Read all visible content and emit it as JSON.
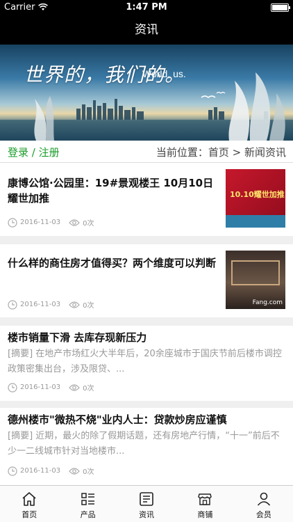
{
  "status_bar": {
    "carrier": "Carrier",
    "time": "1:47 PM"
  },
  "nav": {
    "title": "资讯"
  },
  "banner": {
    "slogan_cn": "世界的，我们的。",
    "slogan_en": "World, us."
  },
  "subheader": {
    "login": "登录 / 注册",
    "breadcrumb": "当前位置：首页 > 新闻资讯"
  },
  "articles": [
    {
      "title": "康博公馆·公园里：19#景观楼王 10月10日耀世加推",
      "summary": "",
      "date": "2016-11-03",
      "views": "0次",
      "thumb_text": "10.10耀世加推"
    },
    {
      "title": "什么样的商住房才值得买？两个维度可以判断",
      "summary": "",
      "date": "2016-11-03",
      "views": "0次",
      "thumb_text": "Fang.com"
    },
    {
      "title": "楼市销量下滑 去库存现新压力",
      "summary": "[摘要] 在地产市场红火大半年后，20余座城市于国庆节前后楼市调控政策密集出台，涉及限贷、...",
      "date": "2016-11-03",
      "views": "0次"
    },
    {
      "title": "德州楼市\"微热不烧\"业内人士：贷款炒房应谨慎",
      "summary": "[摘要] 近期，最火的除了假期话题，还有房地产行情，“十一”前后不少一二线城市针对当地楼市...",
      "date": "2016-11-03",
      "views": "0次"
    }
  ],
  "tabs": [
    {
      "label": "首页",
      "icon": "home-icon"
    },
    {
      "label": "产品",
      "icon": "list-icon"
    },
    {
      "label": "资讯",
      "icon": "news-icon"
    },
    {
      "label": "商铺",
      "icon": "shop-icon"
    },
    {
      "label": "会员",
      "icon": "user-icon"
    }
  ],
  "colors": {
    "accent_green": "#1a9c2a",
    "nav_bg": "#000000"
  }
}
